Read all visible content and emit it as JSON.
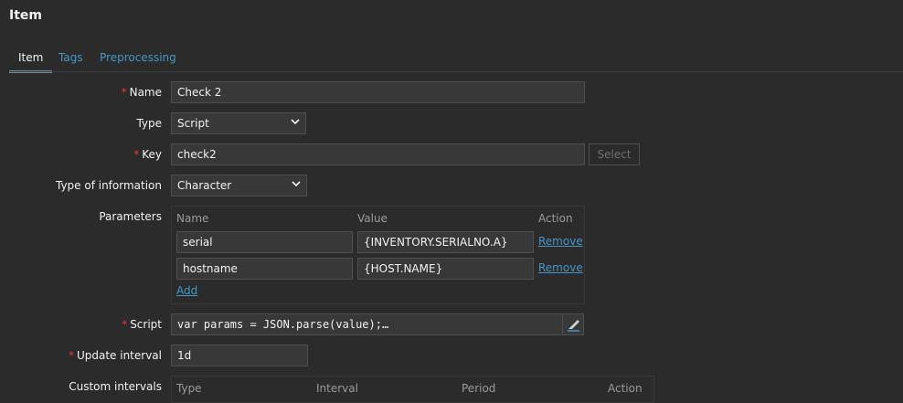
{
  "page": {
    "title": "Item"
  },
  "tabs": [
    {
      "label": "Item",
      "active": true
    },
    {
      "label": "Tags",
      "active": false
    },
    {
      "label": "Preprocessing",
      "active": false
    }
  ],
  "form": {
    "required_mark": "*",
    "name": {
      "label": "Name",
      "value": "Check 2"
    },
    "type": {
      "label": "Type",
      "value": "Script"
    },
    "key": {
      "label": "Key",
      "value": "check2",
      "select_button": "Select"
    },
    "type_of_information": {
      "label": "Type of information",
      "value": "Character"
    },
    "parameters": {
      "label": "Parameters",
      "headers": {
        "name": "Name",
        "value": "Value",
        "action": "Action"
      },
      "rows": [
        {
          "name": "serial",
          "value": "{INVENTORY.SERIALNO.A}",
          "action": "Remove"
        },
        {
          "name": "hostname",
          "value": "{HOST.NAME}",
          "action": "Remove"
        }
      ],
      "add": "Add"
    },
    "script": {
      "label": "Script",
      "value": "var params = JSON.parse(value);…",
      "edit_icon": "pencil-icon"
    },
    "update_interval": {
      "label": "Update interval",
      "value": "1d"
    },
    "custom_intervals": {
      "label": "Custom intervals",
      "headers": {
        "type": "Type",
        "interval": "Interval",
        "period": "Period",
        "action": "Action"
      }
    }
  },
  "colors": {
    "background": "#2b2b2b",
    "input_bg": "#383838",
    "link": "#4796c4",
    "required": "#e33734",
    "tab_underline": "#768d99"
  }
}
